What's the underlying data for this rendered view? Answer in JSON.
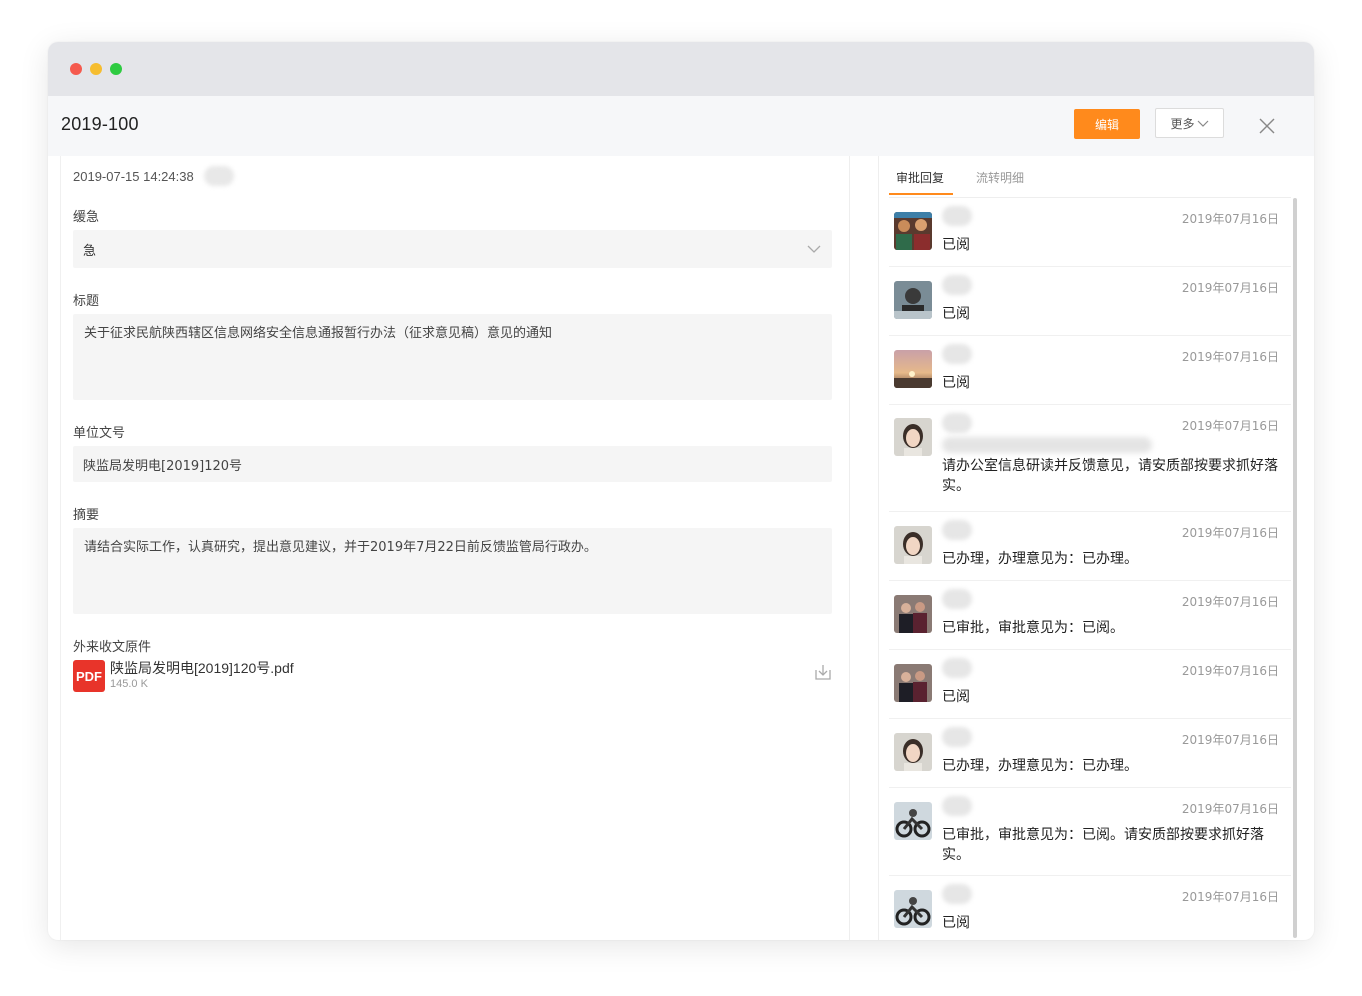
{
  "window": {
    "title": "2019-100",
    "edit_label": "编辑",
    "more_label": "更多",
    "accent": "#ff8a1c"
  },
  "form": {
    "datetime": "2019-07-15 14:24:38",
    "urgency_label": "缓急",
    "urgency_value": "急",
    "title_label": "标题",
    "title_value": "关于征求民航陕西辖区信息网络安全信息通报暂行办法（征求意见稿）意见的通知",
    "doc_number_label": "单位文号",
    "doc_number_value": "陕监局发明电[2019]120号",
    "summary_label": "摘要",
    "summary_value": "请结合实际工作，认真研究，提出意见建议，并于2019年7月22日前反馈监管局行政办。",
    "attachment_label": "外来收文原件",
    "attachment": {
      "icon_text": "PDF",
      "name": "陕监局发明电[2019]120号.pdf",
      "size": "145.0 K"
    }
  },
  "tabs": [
    {
      "label": "审批回复"
    },
    {
      "label": "流转明细"
    }
  ],
  "replies": [
    {
      "date": "2019年07月16日",
      "text": "已阅",
      "avatar": "avatar-group-icon"
    },
    {
      "date": "2019年07月16日",
      "text": "已阅",
      "avatar": "avatar-portrait-icon"
    },
    {
      "date": "2019年07月16日",
      "text": "已阅",
      "avatar": "avatar-sunset-icon"
    },
    {
      "date": "2019年07月16日",
      "text": "请办公室信息研读并反馈意见，请安质部按要求抓好落实。",
      "avatar": "avatar-woman-icon"
    },
    {
      "date": "2019年07月16日",
      "text": "已办理，办理意见为：已办理。",
      "avatar": "avatar-woman-icon"
    },
    {
      "date": "2019年07月16日",
      "text": "已审批，审批意见为：已阅。",
      "avatar": "avatar-couple-icon"
    },
    {
      "date": "2019年07月16日",
      "text": "已阅",
      "avatar": "avatar-couple-icon"
    },
    {
      "date": "2019年07月16日",
      "text": "已办理，办理意见为：已办理。",
      "avatar": "avatar-woman-icon"
    },
    {
      "date": "2019年07月16日",
      "text": "已审批，审批意见为：已阅。请安质部按要求抓好落实。",
      "avatar": "avatar-motorbike-icon"
    },
    {
      "date": "2019年07月16日",
      "text": "已阅",
      "avatar": "avatar-motorbike-icon"
    }
  ]
}
